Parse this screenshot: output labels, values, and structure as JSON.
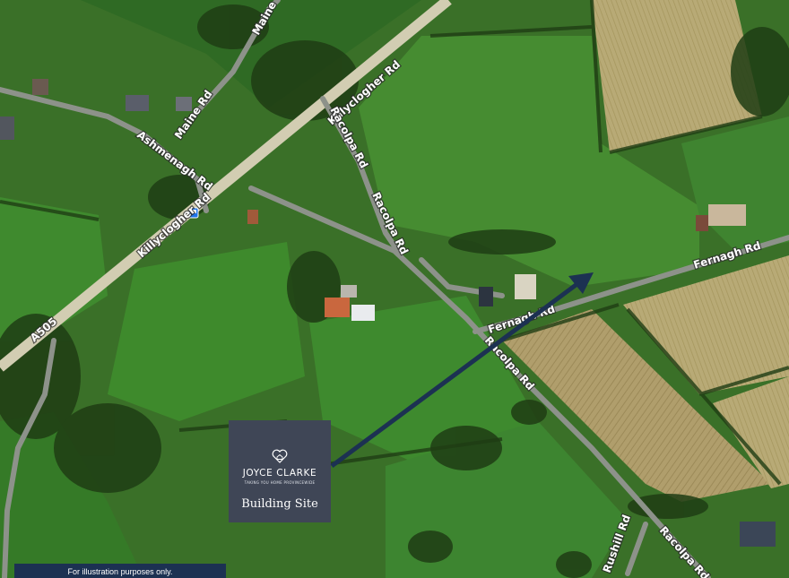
{
  "map": {
    "type": "satellite",
    "roads": [
      {
        "id": "a505",
        "label": "A505"
      },
      {
        "id": "killyclogher-upper",
        "label": "Killyclogher Rd"
      },
      {
        "id": "killyclogher-lower",
        "label": "Killyclogher Rd"
      },
      {
        "id": "maine",
        "label": "Maine Rd"
      },
      {
        "id": "maine-short",
        "label": "Maine"
      },
      {
        "id": "ashmenagh",
        "label": "Ashmenagh Rd"
      },
      {
        "id": "racolpa-1",
        "label": "Racolpa Rd"
      },
      {
        "id": "racolpa-2",
        "label": "Racolpa Rd"
      },
      {
        "id": "racolpa-3",
        "label": "Racolpa Rd"
      },
      {
        "id": "racolpa-4",
        "label": "Racolpa Rd"
      },
      {
        "id": "fernagh-1",
        "label": "Fernagh Rd"
      },
      {
        "id": "fernagh-2",
        "label": "Fernagh Rd"
      },
      {
        "id": "rushill",
        "label": "Rushill Rd"
      }
    ],
    "colors": {
      "field_green": "#3e7a2c",
      "dark_vegetation": "#1f3d14",
      "stubble_field": "#a89a6a",
      "main_road": "#d2cdb2",
      "minor_road": "#8d928a",
      "arrow": "#1c3152"
    },
    "marker": {
      "icon": "bus-stop-icon"
    }
  },
  "brand_card": {
    "logo_icon": "joyce-clarke-heart-house-logo-icon",
    "brand_name": "JOYCE CLARKE",
    "tagline": "TAKING YOU HOME PROVINCEWIDE",
    "site_label": "Building Site",
    "background": "#3f4656"
  },
  "footer": {
    "note": "For illustration purposes only."
  }
}
